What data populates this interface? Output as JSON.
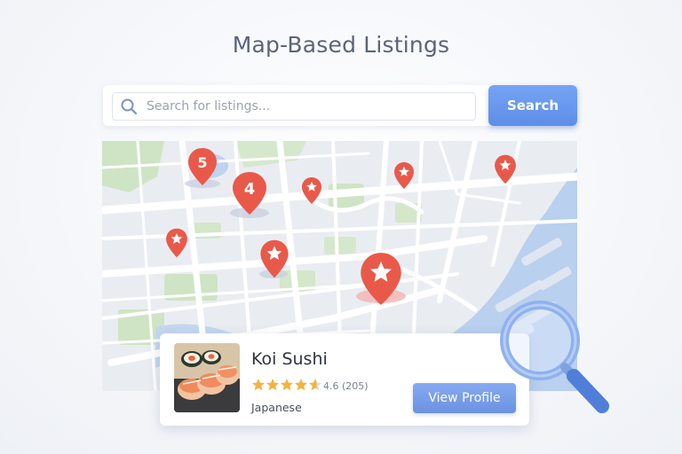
{
  "page": {
    "title": "Map-Based Listings"
  },
  "search": {
    "placeholder": "Search for listings...",
    "value": "",
    "button_label": "Search",
    "icon": "search-icon"
  },
  "map": {
    "markers": [
      {
        "id": "cluster-5",
        "type": "cluster",
        "label": "5"
      },
      {
        "id": "cluster-4",
        "type": "cluster",
        "label": "4"
      },
      {
        "id": "star-a",
        "type": "star",
        "label": ""
      },
      {
        "id": "star-b",
        "type": "star",
        "label": ""
      },
      {
        "id": "star-c",
        "type": "star",
        "label": ""
      },
      {
        "id": "star-d",
        "type": "star",
        "label": ""
      },
      {
        "id": "star-e",
        "type": "star",
        "label": ""
      },
      {
        "id": "star-selected",
        "type": "star-selected",
        "label": ""
      }
    ],
    "colors": {
      "marker": "#e9594a",
      "water": "#b9d0ee",
      "park": "#cfe4c4",
      "road": "#ffffff"
    }
  },
  "listing": {
    "name": "Koi Sushi",
    "rating": 4.6,
    "rating_text": "4.6 (205)",
    "stars_max": 5,
    "category": "Japanese",
    "button_label": "View Profile",
    "image": "sushi-roll-photo"
  },
  "decor": {
    "magnifier": "magnifying-glass-icon"
  },
  "colors": {
    "accent": "#5d8ee8",
    "star": "#f3b33d",
    "star_empty": "#d9dce2"
  }
}
